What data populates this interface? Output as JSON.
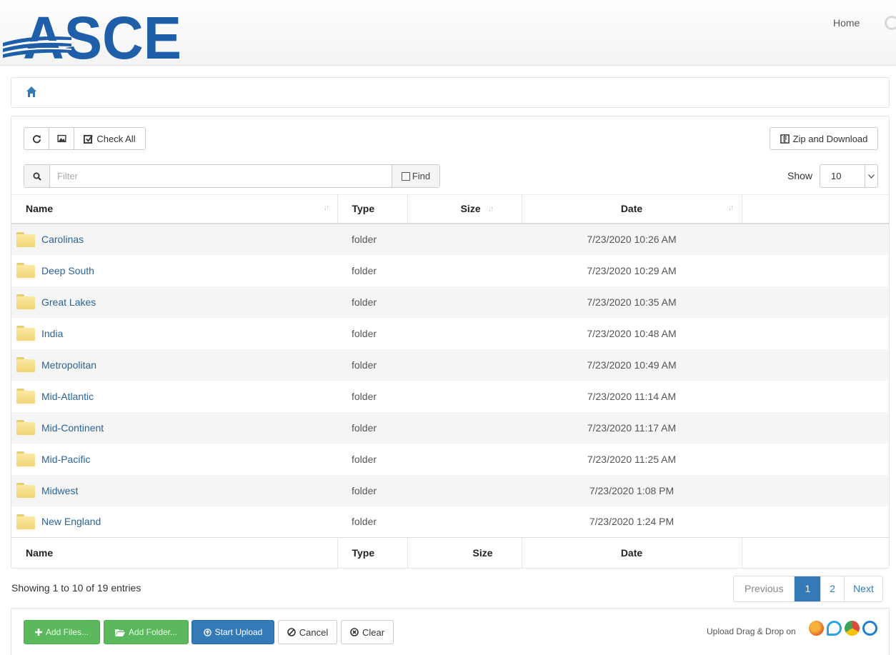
{
  "header": {
    "logo_text": "ASCE",
    "home_link": "Home",
    "user_icon": "user-spinner-icon"
  },
  "breadcrumb": {
    "icon": "home-icon"
  },
  "toolbar": {
    "refresh_icon": "refresh-icon",
    "image_icon": "image-icon",
    "check_all": "Check All",
    "zip_download": "Zip and Download"
  },
  "filter": {
    "placeholder": "Filter",
    "find_label": "Find"
  },
  "show": {
    "label": "Show",
    "value": "10"
  },
  "table": {
    "columns": {
      "name": "Name",
      "type": "Type",
      "size": "Size",
      "date": "Date"
    },
    "rows": [
      {
        "name": "Carolinas",
        "type": "folder",
        "size": "",
        "date": "7/23/2020 10:26 AM"
      },
      {
        "name": "Deep South",
        "type": "folder",
        "size": "",
        "date": "7/23/2020 10:29 AM"
      },
      {
        "name": "Great Lakes",
        "type": "folder",
        "size": "",
        "date": "7/23/2020 10:35 AM"
      },
      {
        "name": "India",
        "type": "folder",
        "size": "",
        "date": "7/23/2020 10:48 AM"
      },
      {
        "name": "Metropolitan",
        "type": "folder",
        "size": "",
        "date": "7/23/2020 10:49 AM"
      },
      {
        "name": "Mid-Atlantic",
        "type": "folder",
        "size": "",
        "date": "7/23/2020 11:14 AM"
      },
      {
        "name": "Mid-Continent",
        "type": "folder",
        "size": "",
        "date": "7/23/2020 11:17 AM"
      },
      {
        "name": "Mid-Pacific",
        "type": "folder",
        "size": "",
        "date": "7/23/2020 11:25 AM"
      },
      {
        "name": "Midwest",
        "type": "folder",
        "size": "",
        "date": "7/23/2020 1:08 PM"
      },
      {
        "name": "New England",
        "type": "folder",
        "size": "",
        "date": "7/23/2020 1:24 PM"
      }
    ]
  },
  "info": "Showing 1 to 10 of 19 entries",
  "pagination": {
    "previous": "Previous",
    "pages": [
      "1",
      "2"
    ],
    "active_page": "1",
    "next": "Next"
  },
  "upload": {
    "add_files": "Add Files...",
    "add_folder": "Add Folder...",
    "start_upload": "Start Upload",
    "cancel": "Cancel",
    "clear": "Clear",
    "drag_drop": "Upload Drag & Drop on"
  },
  "colors": {
    "brand_blue": "#1f5fa9",
    "primary": "#337ab7",
    "success": "#5cb85c",
    "link": "#2a6496"
  },
  "icons": [
    "home-icon",
    "refresh-icon",
    "image-icon",
    "check-square-icon",
    "zip-icon",
    "search-icon",
    "checkbox-icon",
    "sort-icon",
    "folder-icon",
    "plus-icon",
    "folder-open-icon",
    "upload-icon",
    "cancel-icon",
    "clear-icon",
    "firefox-icon",
    "ie-icon",
    "chrome-icon",
    "safari-icon"
  ]
}
